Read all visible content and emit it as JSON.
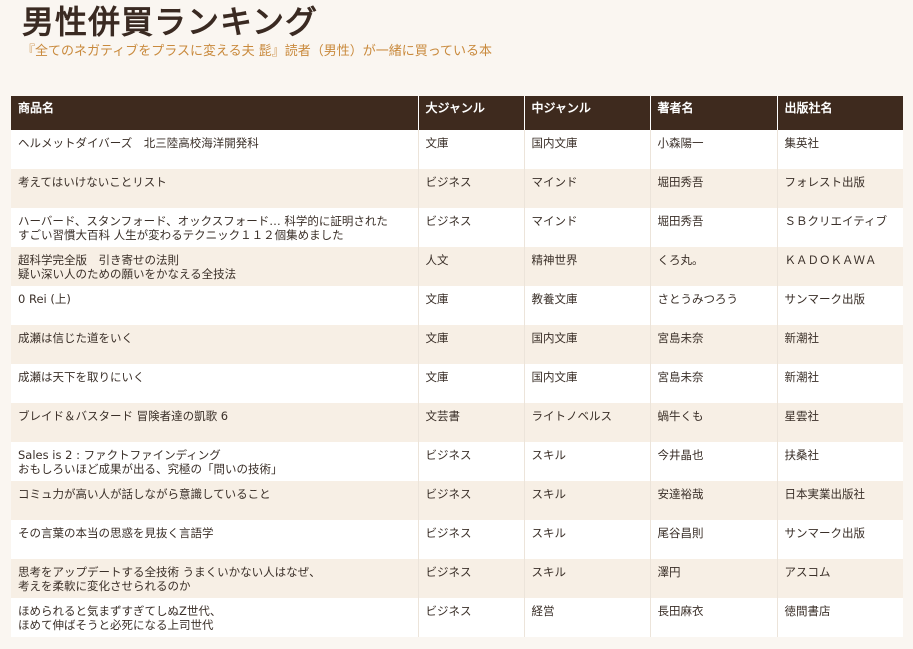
{
  "header": {
    "title": "男性併買ランキング",
    "subtitle": "『全てのネガティブをプラスに変える夫 髭』読者（男性）が一緒に買っている本"
  },
  "table": {
    "columns": [
      "商品名",
      "大ジャンル",
      "中ジャンル",
      "著者名",
      "出版社名"
    ],
    "rows": [
      {
        "title": [
          "ヘルメットダイバーズ　北三陸高校海洋開発科"
        ],
        "genre": "文庫",
        "subgenre": "国内文庫",
        "author": "小森陽一",
        "publisher": "集英社"
      },
      {
        "title": [
          "考えてはいけないことリスト"
        ],
        "genre": "ビジネス",
        "subgenre": "マインド",
        "author": "堀田秀吾",
        "publisher": "フォレスト出版"
      },
      {
        "title": [
          "ハーバード、スタンフォード、オックスフォード… 科学的に証明された",
          "すごい習慣大百科 人生が変わるテクニック１１２個集めました"
        ],
        "genre": "ビジネス",
        "subgenre": "マインド",
        "author": "堀田秀吾",
        "publisher": "ＳＢクリエイティブ"
      },
      {
        "title": [
          "超科学完全版　引き寄せの法則",
          "疑い深い人のための願いをかなえる全技法"
        ],
        "genre": "人文",
        "subgenre": "精神世界",
        "author": "くろ丸。",
        "publisher": "ＫＡＤＯＫＡＷＡ"
      },
      {
        "title": [
          "0 Rei (上)"
        ],
        "genre": "文庫",
        "subgenre": "教養文庫",
        "author": "さとうみつろう",
        "publisher": "サンマーク出版"
      },
      {
        "title": [
          "成瀬は信じた道をいく"
        ],
        "genre": "文庫",
        "subgenre": "国内文庫",
        "author": "宮島未奈",
        "publisher": "新潮社"
      },
      {
        "title": [
          "成瀬は天下を取りにいく"
        ],
        "genre": "文庫",
        "subgenre": "国内文庫",
        "author": "宮島未奈",
        "publisher": "新潮社"
      },
      {
        "title": [
          "ブレイド＆バスタード 冒険者達の凱歌 6"
        ],
        "genre": "文芸書",
        "subgenre": "ライトノベルス",
        "author": "蝸牛くも",
        "publisher": "星雲社"
      },
      {
        "title": [
          "Sales is 2 : ファクトファインディング",
          " おもしろいほど成果が出る、究極の「問いの技術」"
        ],
        "genre": "ビジネス",
        "subgenre": "スキル",
        "author": "今井晶也",
        "publisher": "扶桑社"
      },
      {
        "title": [
          "コミュ力が高い人が話しながら意識していること"
        ],
        "genre": "ビジネス",
        "subgenre": "スキル",
        "author": "安達裕哉",
        "publisher": "日本実業出版社"
      },
      {
        "title": [
          "その言葉の本当の思惑を見抜く言語学"
        ],
        "genre": "ビジネス",
        "subgenre": "スキル",
        "author": "尾谷昌則",
        "publisher": "サンマーク出版"
      },
      {
        "title": [
          "思考をアップデートする全技術 うまくいかない人はなぜ、",
          "考えを柔軟に変化させられるのか"
        ],
        "genre": "ビジネス",
        "subgenre": "スキル",
        "author": "澤円",
        "publisher": "アスコム"
      },
      {
        "title": [
          "ほめられると気まずすぎてしぬZ世代、",
          "ほめて伸ばそうと必死になる上司世代"
        ],
        "genre": "ビジネス",
        "subgenre": "経営",
        "author": "長田麻衣",
        "publisher": "徳間書店"
      }
    ]
  }
}
